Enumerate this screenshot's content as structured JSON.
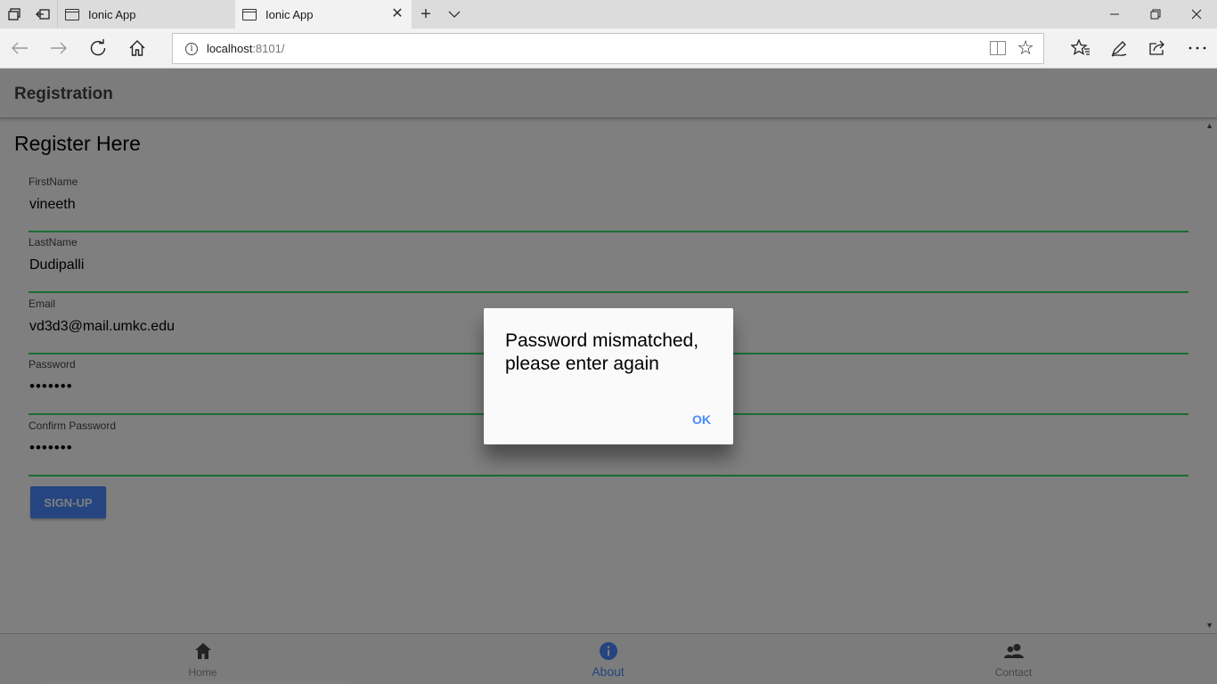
{
  "browser": {
    "tabs": [
      {
        "title": "Ionic App",
        "active": false
      },
      {
        "title": "Ionic App",
        "active": true
      }
    ],
    "address": {
      "host": "localhost",
      "rest": ":8101/"
    },
    "icons": {
      "back": "arrow-left-icon",
      "forward": "arrow-right-icon",
      "refresh": "refresh-icon",
      "home": "home-icon",
      "favorites": "favorites-icon",
      "notes": "pen-icon",
      "share": "share-icon",
      "more": "more-icon"
    }
  },
  "app": {
    "header_title": "Registration",
    "page_heading": "Register Here",
    "fields": [
      {
        "label": "FirstName",
        "value": "vineeth"
      },
      {
        "label": "LastName",
        "value": "Dudipalli"
      },
      {
        "label": "Email",
        "value": "vd3d3@mail.umkc.edu"
      },
      {
        "label": "Password",
        "value": "•••••••"
      },
      {
        "label": "Confirm Password",
        "value": "•••••••"
      }
    ],
    "signup_label": "SIGN-UP",
    "tabs": [
      {
        "label": "Home",
        "icon": "home-icon",
        "selected": false
      },
      {
        "label": "About",
        "icon": "info-icon",
        "selected": true
      },
      {
        "label": "Contact",
        "icon": "contacts-icon",
        "selected": false
      }
    ]
  },
  "alert": {
    "message": "Password mismatched, please enter again",
    "ok_label": "OK"
  },
  "colors": {
    "primary": "#488aff",
    "field_underline": "#32db64",
    "header_bg": "#f8f8f8",
    "backdrop": "rgba(0,0,0,0.5)"
  }
}
